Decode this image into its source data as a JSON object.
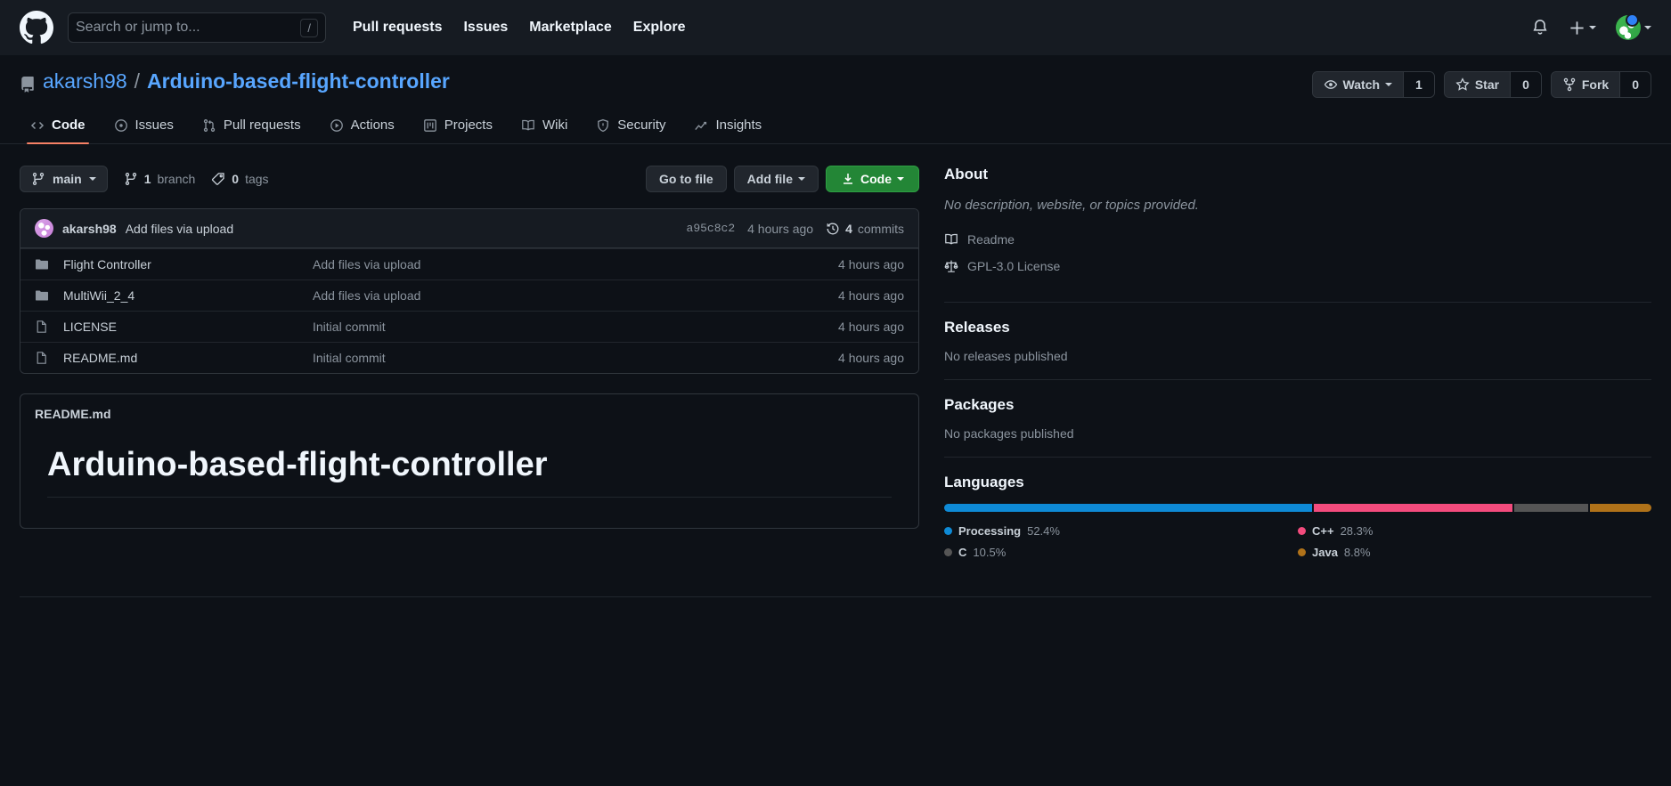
{
  "header": {
    "logo_icon": "github-mark-icon",
    "search": {
      "placeholder": "Search or jump to...",
      "value": "",
      "shortcut": "/"
    },
    "nav": [
      {
        "label": "Pull requests"
      },
      {
        "label": "Issues"
      },
      {
        "label": "Marketplace"
      },
      {
        "label": "Explore"
      }
    ],
    "notifications_icon": "bell-icon",
    "create_new_icon": "plus-icon",
    "account_icon": "avatar"
  },
  "repo": {
    "icon": "repo-icon",
    "owner": "akarsh98",
    "separator": "/",
    "name": "Arduino-based-flight-controller",
    "actions": [
      {
        "label": "Watch",
        "icon": "eye-icon",
        "count": "1",
        "has_caret": true
      },
      {
        "label": "Star",
        "icon": "star-icon",
        "count": "0",
        "has_caret": false
      },
      {
        "label": "Fork",
        "icon": "fork-icon",
        "count": "0",
        "has_caret": false
      }
    ]
  },
  "tabs": [
    {
      "label": "Code",
      "icon": "code-icon",
      "active": true
    },
    {
      "label": "Issues",
      "icon": "issue-opened-icon",
      "active": false
    },
    {
      "label": "Pull requests",
      "icon": "git-pull-request-icon",
      "active": false
    },
    {
      "label": "Actions",
      "icon": "play-icon",
      "active": false
    },
    {
      "label": "Projects",
      "icon": "project-icon",
      "active": false
    },
    {
      "label": "Wiki",
      "icon": "book-icon",
      "active": false
    },
    {
      "label": "Security",
      "icon": "shield-icon",
      "active": false
    },
    {
      "label": "Insights",
      "icon": "graph-icon",
      "active": false
    }
  ],
  "branch_bar": {
    "branch_name": "main",
    "branch_icon": "git-branch-icon",
    "branches_count": "1",
    "branches_label": "branch",
    "tags_count": "0",
    "tags_label": "tags",
    "tag_icon": "tag-icon",
    "go_to_file": "Go to file",
    "add_file": "Add file",
    "code_button": "Code",
    "code_icon": "download-icon"
  },
  "commit_bar": {
    "author": "akarsh98",
    "message": "Add files via upload",
    "sha": "a95c8c2",
    "time": "4 hours ago",
    "commits_count": "4",
    "commits_label": "commits",
    "history_icon": "history-icon"
  },
  "files": [
    {
      "type": "folder",
      "icon": "folder-icon",
      "name": "Flight Controller",
      "message": "Add files via upload",
      "time": "4 hours ago"
    },
    {
      "type": "folder",
      "icon": "folder-icon",
      "name": "MultiWii_2_4",
      "message": "Add files via upload",
      "time": "4 hours ago"
    },
    {
      "type": "file",
      "icon": "file-icon",
      "name": "LICENSE",
      "message": "Initial commit",
      "time": "4 hours ago"
    },
    {
      "type": "file",
      "icon": "file-icon",
      "name": "README.md",
      "message": "Initial commit",
      "time": "4 hours ago"
    }
  ],
  "readme": {
    "filename": "README.md",
    "heading": "Arduino-based-flight-controller"
  },
  "sidebar": {
    "about": {
      "title": "About",
      "description": "No description, website, or topics provided.",
      "links": [
        {
          "label": "Readme",
          "icon": "book-icon"
        },
        {
          "label": "GPL-3.0 License",
          "icon": "law-icon"
        }
      ]
    },
    "releases": {
      "title": "Releases",
      "empty": "No releases published"
    },
    "packages": {
      "title": "Packages",
      "empty": "No packages published"
    },
    "languages": {
      "title": "Languages",
      "items": [
        {
          "name": "Processing",
          "percent": "52.4%",
          "value": 52.4,
          "color": "#0e8ad6"
        },
        {
          "name": "C++",
          "percent": "28.3%",
          "value": 28.3,
          "color": "#f34b7d"
        },
        {
          "name": "C",
          "percent": "10.5%",
          "value": 10.5,
          "color": "#555555"
        },
        {
          "name": "Java",
          "percent": "8.8%",
          "value": 8.8,
          "color": "#b07219"
        }
      ]
    }
  },
  "colors": {
    "page_bg": "#0d1117",
    "header_bg": "#161b22",
    "border": "#30363d",
    "link": "#58a6ff",
    "accent_green": "#238636",
    "active_tab": "#f78166"
  }
}
